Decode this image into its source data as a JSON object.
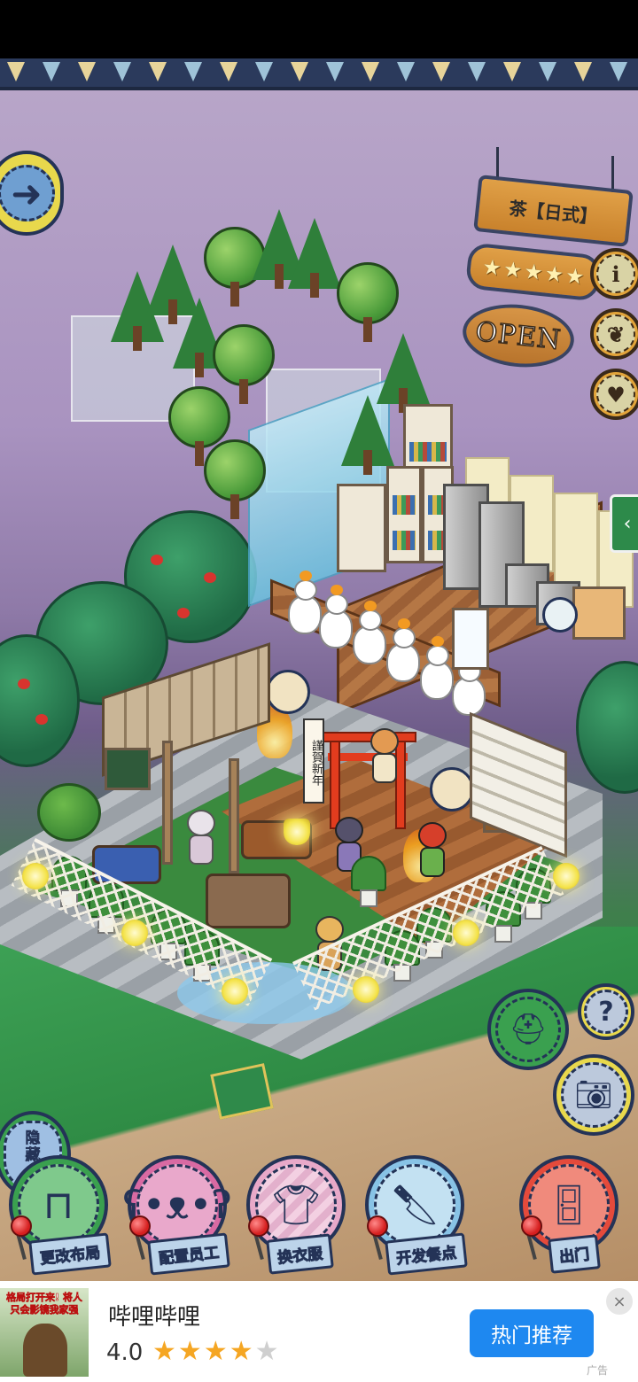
{
  "shop_sign": {
    "title": "茶【日式】",
    "stars": 5,
    "status": "OPEN"
  },
  "decor": {
    "banner_text": "謹賀新年"
  },
  "side_buttons": {
    "info": "i",
    "menu_book_icon": "book-icon",
    "love_icon": "heart-icon",
    "expand_tab": "‹"
  },
  "hide_button": {
    "label_line1": "隐",
    "label_line2": "藏"
  },
  "right_tools": {
    "help": "?",
    "camera_icon": "camera-icon",
    "hat_icon": "hat-icon"
  },
  "bottom_bar": {
    "items": [
      {
        "label": "更改布局",
        "icon": "table-icon",
        "color": "#3aa04f"
      },
      {
        "label": "配置员工",
        "icon": "bear-icon",
        "color": "#d96aa3"
      },
      {
        "label": "换衣服",
        "icon": "shirt-icon",
        "color": "#e8a9c9"
      },
      {
        "label": "开发餐点",
        "icon": "knife-icon",
        "color": "#88c3e6"
      },
      {
        "label": "出门",
        "icon": "door-icon",
        "color": "#e54a3b"
      }
    ]
  },
  "ad": {
    "thumb_text": "格局打开来! 将人只会影镜我家强",
    "app_name": "哔哩哔哩",
    "rating": "4.0",
    "stars_on": 4,
    "stars_total": 5,
    "cta": "热门推荐",
    "close": "×",
    "tag": "广告"
  }
}
